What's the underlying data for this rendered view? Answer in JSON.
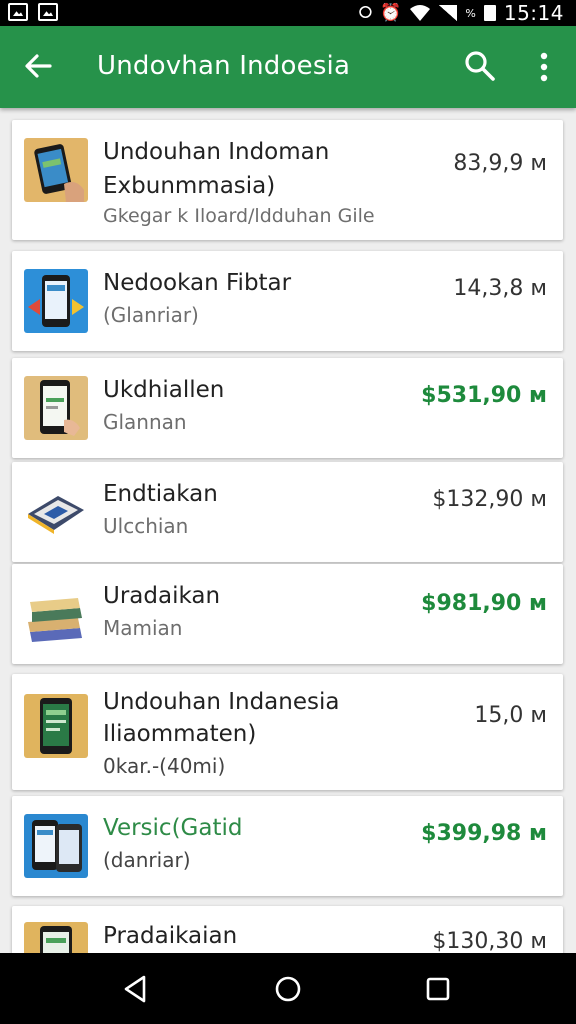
{
  "status_bar": {
    "left_icons": [
      "gmail-icon",
      "gallery-icon"
    ],
    "right_icons": [
      "nfc-icon",
      "alarm-icon",
      "wifi-icon",
      "signal-icon"
    ],
    "battery_text": "%",
    "time": "15:14"
  },
  "app_bar": {
    "title": "Undovhan Indoesia",
    "back_icon": "arrow-left-icon",
    "search_icon": "search-icon",
    "more_icon": "more-vertical-icon"
  },
  "colors": {
    "app_bar": "#26924a",
    "price_green": "#1e8a3c"
  },
  "items": [
    {
      "title": "Undouhan Indoman",
      "title2": "Exbunmmasia)",
      "subtitle": "Gkegar k Iloard/ldduhan Gile",
      "price": "83,9,9 м",
      "price_green": false,
      "thumb": "phone-in-hand"
    },
    {
      "title": "Nedookan Fibtar",
      "title2": "",
      "subtitle": "(Glanriar)",
      "price": "14,3,8 м",
      "price_green": false,
      "thumb": "blue-phone"
    },
    {
      "title": "Ukdhiallen",
      "title2": "",
      "subtitle": "Glannan",
      "price": "$531,90 м",
      "price_green": true,
      "thumb": "phone-hand-tan"
    },
    {
      "title": "Endtiakan",
      "title2": "",
      "subtitle": "Ulcchian",
      "price": "$132,90 м",
      "price_green": false,
      "thumb": "tablet-box"
    },
    {
      "title": "Uradaikan",
      "title2": "",
      "subtitle": "Mamian",
      "price": "$981,90 м",
      "price_green": true,
      "thumb": "books-stack"
    },
    {
      "title": "Undouhan Indanesia",
      "title2": "Iliaommaten)",
      "subtitle": "0kar.-(40mi)",
      "price": "15,0 м",
      "price_green": false,
      "thumb": "green-phone"
    },
    {
      "title": "Versic(Gatid",
      "title2": "",
      "subtitle": "(danriar)",
      "price": "$399,98 м",
      "price_green": true,
      "title_green": true,
      "thumb": "phones-blue"
    },
    {
      "title": "Pradaikaian",
      "title2": "",
      "subtitle": "",
      "price": "$130,30 м",
      "price_green": false,
      "thumb": "phone-tan"
    }
  ],
  "nav_bar": {
    "back_icon": "nav-back-icon",
    "home_icon": "nav-home-icon",
    "recents_icon": "nav-recents-icon"
  }
}
